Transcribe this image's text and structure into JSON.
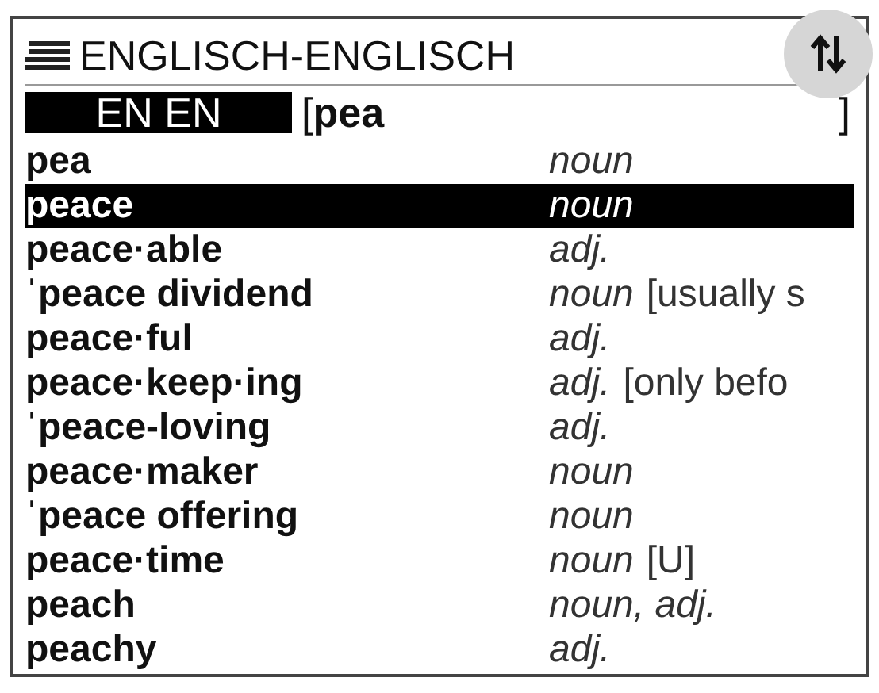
{
  "window": {
    "title": "ENGLISCH-ENGLISCH"
  },
  "search": {
    "mode": "EN EN",
    "open_bracket": "[",
    "value": "pea",
    "close_bracket": "]"
  },
  "entries": [
    {
      "headword": "pea",
      "pos": "noun",
      "selected": false
    },
    {
      "headword": "peace",
      "pos": "noun",
      "selected": true
    },
    {
      "headword": "peace·able",
      "pos": "adj.",
      "selected": false
    },
    {
      "headword": "ˈpeace dividend",
      "pos": "noun",
      "note": "[usually s",
      "selected": false
    },
    {
      "headword": "peace·ful",
      "pos": "adj.",
      "selected": false
    },
    {
      "headword": "peace·keep·ing",
      "pos": "adj.",
      "note": "[only befo",
      "selected": false
    },
    {
      "headword": "ˈpeace-loving",
      "pos": "adj.",
      "selected": false
    },
    {
      "headword": "peace·maker",
      "pos": "noun",
      "selected": false
    },
    {
      "headword": "ˈpeace offering",
      "pos": "noun",
      "selected": false
    },
    {
      "headword": "peace·time",
      "pos": "noun",
      "note": "[U]",
      "selected": false
    },
    {
      "headword": "peach",
      "pos": "noun, adj.",
      "selected": false
    },
    {
      "headword": "peachy",
      "pos": "adj.",
      "selected": false
    }
  ]
}
